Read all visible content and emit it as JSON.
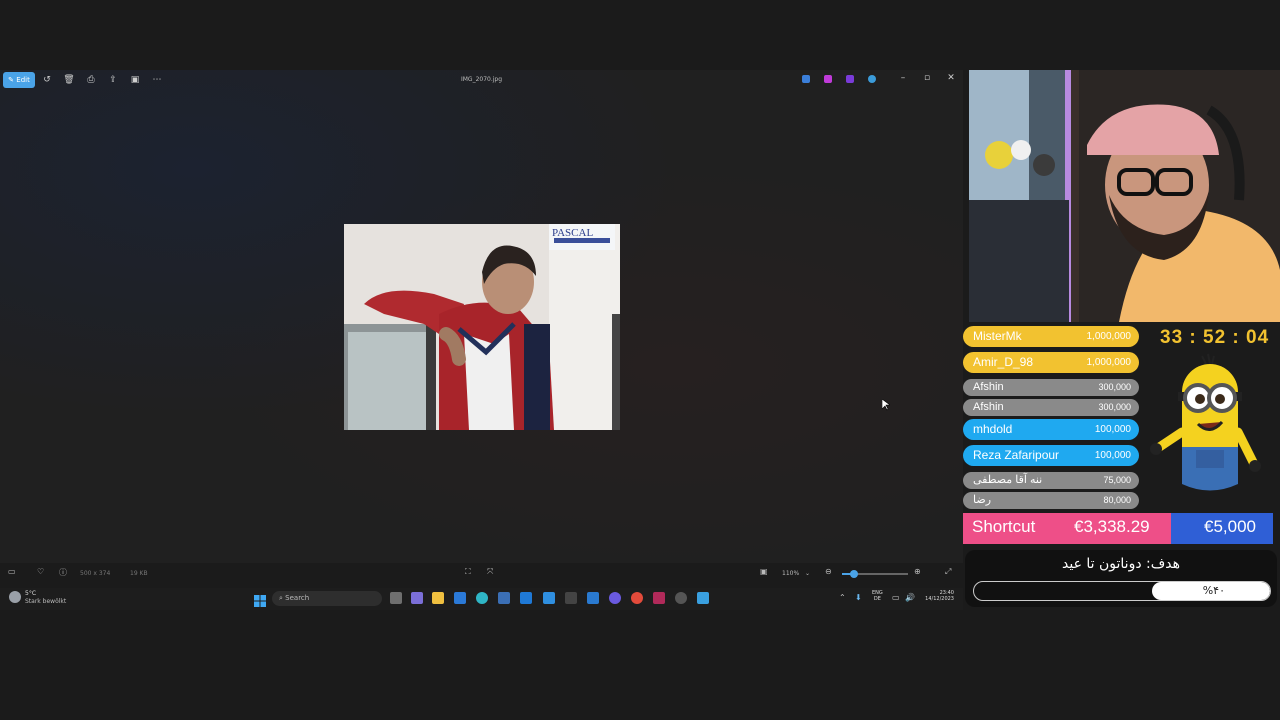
{
  "photos_app": {
    "edit_label": "Edit",
    "title": "IMG_2070.jpg",
    "photo_sign_text": "PASCAL",
    "status": {
      "dimensions": "500 x 374",
      "size": "19 KB",
      "zoom": "110%"
    }
  },
  "taskbar": {
    "weather_temp": "5°C",
    "weather_desc": "Stark bewölkt",
    "search_placeholder": "Search",
    "lang_top": "ENG",
    "lang_bottom": "DE",
    "time": "23:40",
    "date": "14/12/2023"
  },
  "stream": {
    "timer": "33 : 52 : 04",
    "donors": [
      {
        "name": "MisterMk",
        "amount": "1,000,000",
        "color": "#f2c230"
      },
      {
        "name": "Amir_D_98",
        "amount": "1,000,000",
        "color": "#f2c230"
      },
      {
        "name": "Afshin",
        "amount": "300,000",
        "color": "#8a8a8a"
      },
      {
        "name": "Afshin",
        "amount": "300,000",
        "color": "#8a8a8a"
      },
      {
        "name": "mhdold",
        "amount": "100,000",
        "color": "#1fa9f0"
      },
      {
        "name": "Reza Zafaripour",
        "amount": "100,000",
        "color": "#1fa9f0"
      },
      {
        "name": "ننه آقا مصطفی",
        "amount": "75,000",
        "color": "#8a8a8a"
      },
      {
        "name": "رضا",
        "amount": "80,000",
        "color": "#8a8a8a"
      }
    ],
    "shortcut_label": "Shortcut",
    "shortcut_current": "€3,338.29",
    "shortcut_goal": "€5,000",
    "goal_text": "هدف: دوناتون تا عید",
    "goal_progress_label": "%۴۰",
    "goal_progress": 0.4
  }
}
